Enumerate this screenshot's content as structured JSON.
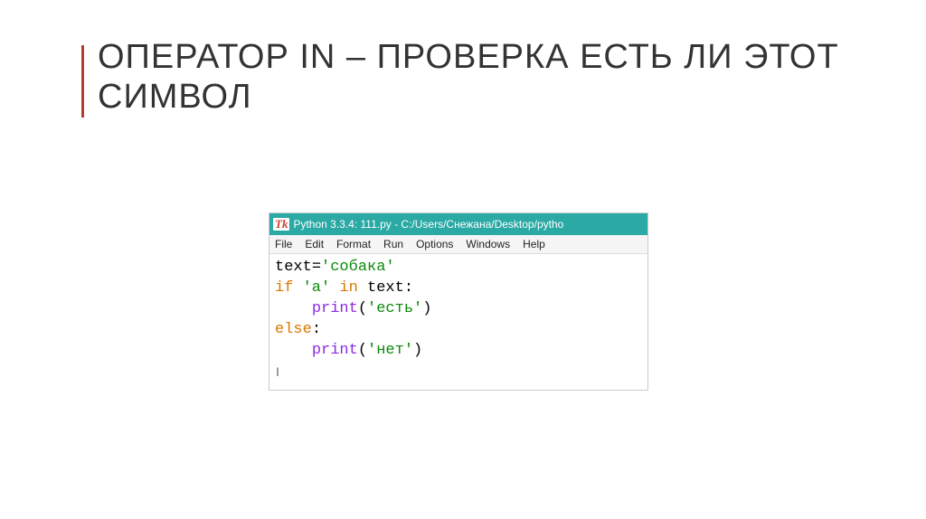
{
  "slide": {
    "title": "ОПЕРАТОР IN – ПРОВЕРКА ЕСТЬ ЛИ ЭТОТ СИМВОЛ"
  },
  "editor": {
    "tk_logo": "Tk",
    "window_title": "Python 3.3.4: 111.py - C:/Users/Снежана/Desktop/pytho",
    "menu": {
      "file": "File",
      "edit": "Edit",
      "format": "Format",
      "run": "Run",
      "options": "Options",
      "windows": "Windows",
      "help": "Help"
    },
    "code": {
      "l1": {
        "var": "text",
        "op": "=",
        "str": "'собака'"
      },
      "l2": {
        "kw1": "if",
        "str": " 'а' ",
        "kw2": "in",
        "var": " text",
        "colon": ":"
      },
      "l3": {
        "indent": "    ",
        "builtin": "print",
        "par1": "(",
        "str": "'есть'",
        "par2": ")"
      },
      "l4": {
        "kw": "else",
        "colon": ":"
      },
      "l5": {
        "indent": "    ",
        "builtin": "print",
        "par1": "(",
        "str": "'нет'",
        "par2": ")"
      }
    }
  }
}
